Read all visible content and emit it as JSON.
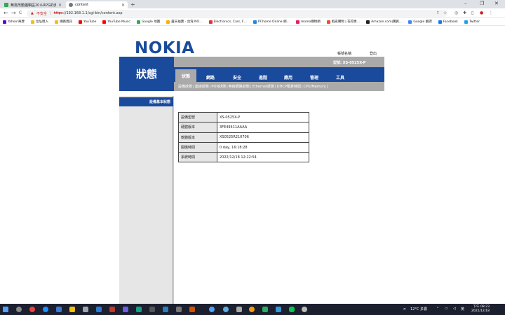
{
  "browser": {
    "tabs": [
      {
        "title": "無需改動邏輯區20ルRPG的步驟的…",
        "active": false,
        "color": "#34a853"
      },
      {
        "title": "content",
        "active": true,
        "color": "#777777"
      }
    ],
    "new_tab": "+",
    "window_controls": {
      "minimize": "–",
      "maximize": "❐",
      "close": "✕"
    },
    "nav": {
      "back": "←",
      "forward": "→",
      "reload": "C"
    },
    "address": {
      "warning": "不安全",
      "url_scheme": "https",
      "url_rest": "://192.168.1.1/cgi-bin/content.asp"
    },
    "bookmarks": [
      {
        "label": "Yahoo!奇摩",
        "color": "#6001d2"
      },
      {
        "label": "位址匯入",
        "color": "#f4c20d"
      },
      {
        "label": "網路資訊",
        "color": "#f4c20d"
      },
      {
        "label": "YouTube",
        "color": "#ff0000"
      },
      {
        "label": "YouTube Music",
        "color": "#ff0000"
      },
      {
        "label": "Google 地圖",
        "color": "#34a853"
      },
      {
        "label": "露天拍賣 - 台灣 NO…",
        "color": "#f4b400"
      },
      {
        "label": "Electronics, Cars, F…",
        "color": "#e53238"
      },
      {
        "label": "PChome Online 網…",
        "color": "#1e88e5"
      },
      {
        "label": "momo購物網",
        "color": "#e91e63"
      },
      {
        "label": "蝦皮購物 | 花得更…",
        "color": "#ee4d2d"
      },
      {
        "label": "Amazon.com|購買…",
        "color": "#222222"
      },
      {
        "label": "Google 翻譯",
        "color": "#4285f4"
      },
      {
        "label": "Facebook",
        "color": "#1877f2"
      },
      {
        "label": "Twitter",
        "color": "#1da1f2"
      }
    ]
  },
  "page": {
    "logo": "NOKIA",
    "user_label": "帳號名稱",
    "logout_label": "登出",
    "model_label": "型號: XS-0525X-P",
    "section_title": "狀態",
    "main_nav": [
      "狀態",
      "網路",
      "安全",
      "進階",
      "應用",
      "管理",
      "工具"
    ],
    "sub_nav": [
      "設備狀態",
      "連線狀態",
      "PON狀態",
      "無線網路狀態",
      "Ethernet狀態",
      "DHCP租賃時間",
      "CPU/Memory"
    ],
    "sidebar_item": "設備基本狀態",
    "device_info": [
      {
        "key": "設備型號",
        "value": "XS-0525X-P"
      },
      {
        "key": "硬體版本",
        "value": "3FE49411AAAA"
      },
      {
        "key": "軟體版本",
        "value": "XS0525R210706"
      },
      {
        "key": "開機時間",
        "value": "0 day, 16:18:28"
      },
      {
        "key": "系統時間",
        "value": "2022/12/18 12:22:54"
      }
    ]
  },
  "taskbar": {
    "weather": "12°C 多雲",
    "time": "下午 08:23",
    "date": "2022/12/18"
  },
  "colors": {
    "brand": "#1a4a9c",
    "gray": "#aaaaaa"
  }
}
